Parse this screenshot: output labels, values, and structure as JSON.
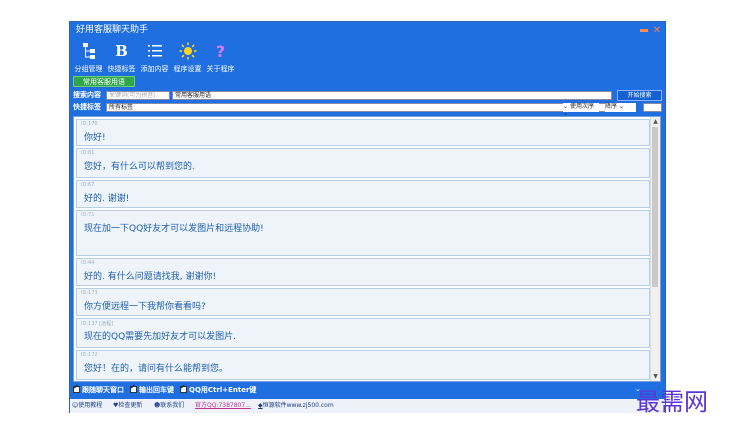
{
  "window": {
    "title": "好用客服聊天助手"
  },
  "toolbar": {
    "items": [
      {
        "label": "分组管理",
        "icon": "group-icon"
      },
      {
        "label": "快捷标签",
        "icon": "bold-icon"
      },
      {
        "label": "添加内容",
        "icon": "list-icon"
      },
      {
        "label": "程序设置",
        "icon": "sun-gear-icon"
      },
      {
        "label": "关于程序",
        "icon": "question-icon"
      }
    ],
    "common_button": "常用客服用语"
  },
  "search": {
    "label": "搜索内容",
    "input_placeholder": "关键词(可为拼音)",
    "select_value": "常用客服用语",
    "button": "开始搜索"
  },
  "tag": {
    "label": "快捷标签",
    "select_value": "所有标签",
    "sort_value": "使用次序",
    "order_value": "降序"
  },
  "messages": [
    {
      "meta": "ID:170",
      "text": "你好!"
    },
    {
      "meta": "ID:81",
      "text": "您好，有什么可以帮到您的."
    },
    {
      "meta": "ID:67",
      "text": "好的. 谢谢!"
    },
    {
      "meta": "ID:71",
      "text": "现在加一下QQ好友才可以发图片和远程协助!"
    },
    {
      "meta": "ID:44",
      "text": "好的. 有什么问题请找我, 谢谢你!"
    },
    {
      "meta": "ID:173",
      "text": "你方便远程一下我帮你看看吗?"
    },
    {
      "meta": "ID:137 [远程]",
      "text": "现在的QQ需要先加好友才可以发图片."
    },
    {
      "meta": "ID:172",
      "text": "您好！在的，请问有什么能帮到您。"
    }
  ],
  "options": [
    "跟随聊天窗口",
    "输出回车键",
    "QQ用Ctrl+Enter键"
  ],
  "footer": {
    "help": "使用教程",
    "update": "检查更新",
    "contact": "联系我们",
    "qq": "官方QQ:7387807...",
    "site": "恒源软件www.zj500.com"
  },
  "watermark": "最需网",
  "colors": {
    "app_bg": "#1f6fe0",
    "message_text": "#2060b0",
    "watermark": "#5b34d8"
  }
}
